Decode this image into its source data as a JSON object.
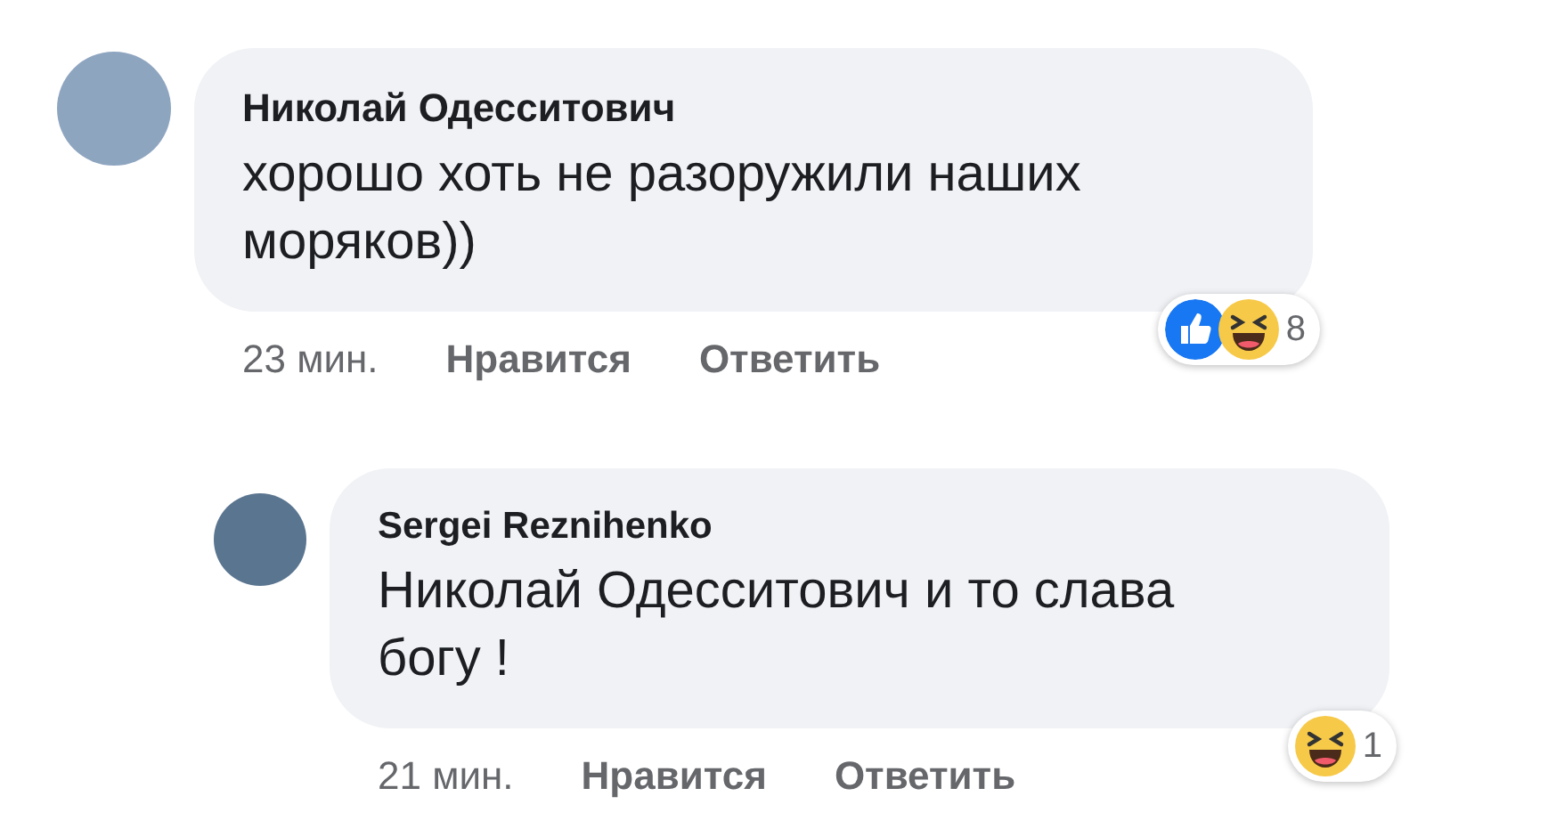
{
  "comments": [
    {
      "author": "Николай Одесситович",
      "text": "хорошо хоть не разоружили наших моряков))",
      "time": "23 мин.",
      "actions": [
        "Нравится",
        "Ответить"
      ],
      "reactions": [
        {
          "kind": "like"
        },
        {
          "kind": "haha"
        }
      ],
      "reaction_count": "8",
      "children": [
        {
          "author": "Sergei Reznihenko",
          "text": "Николай Одесситович и то слава богу !",
          "time": "21 мин.",
          "actions": [
            "Нравится",
            "Ответить"
          ],
          "reactions": [
            {
              "kind": "haha"
            }
          ],
          "reaction_count": "1"
        }
      ]
    }
  ]
}
